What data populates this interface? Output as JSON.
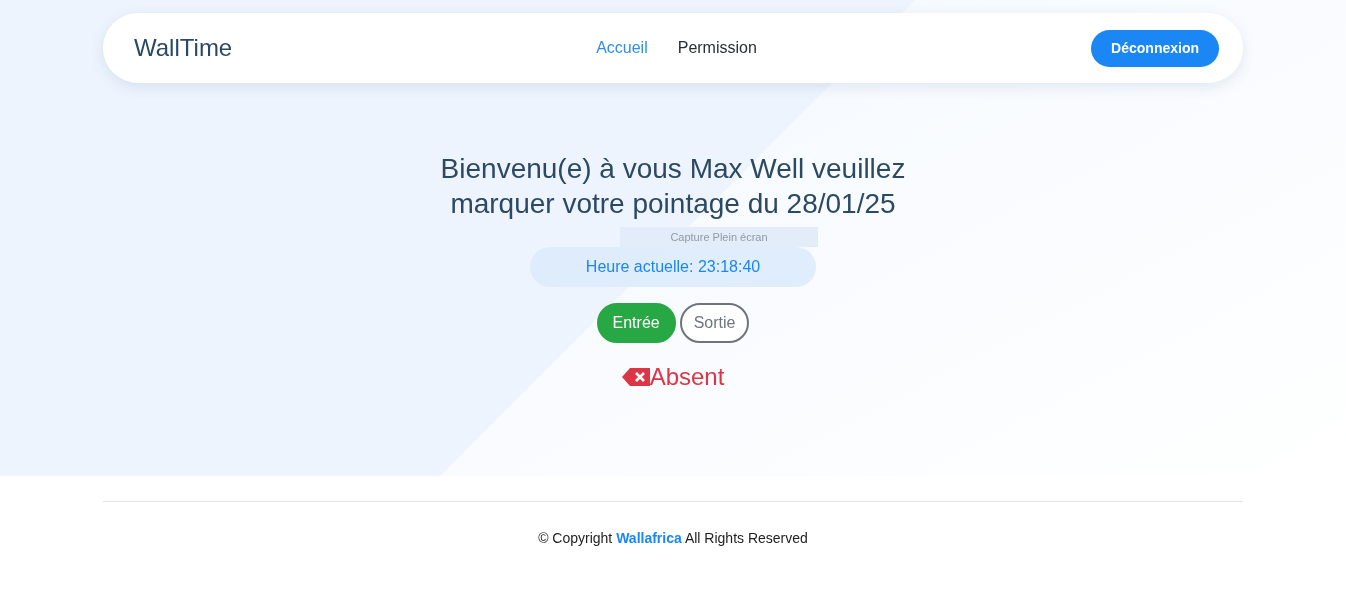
{
  "navbar": {
    "brand": "WallTime",
    "links": [
      {
        "label": "Accueil",
        "selected": true
      },
      {
        "label": "Permission",
        "selected": false
      }
    ],
    "logout_button": "Déconnexion"
  },
  "welcome": {
    "heading": "Bienvenu(e) à vous Max Well veuillez marquer votre pointage du 28/01/25",
    "tooltip": "Capture Plein écran",
    "clock": "Heure actuelle: 23:18:40",
    "actions": [
      {
        "label": "Entrée",
        "selected": true
      },
      {
        "label": "Sortie",
        "selected": false
      }
    ],
    "status": {
      "kind": "absent",
      "label": "Absent"
    }
  },
  "footer": {
    "prefix": "© Copyright",
    "company": "Wallafrica",
    "suffix": "All Rights Reserved"
  }
}
